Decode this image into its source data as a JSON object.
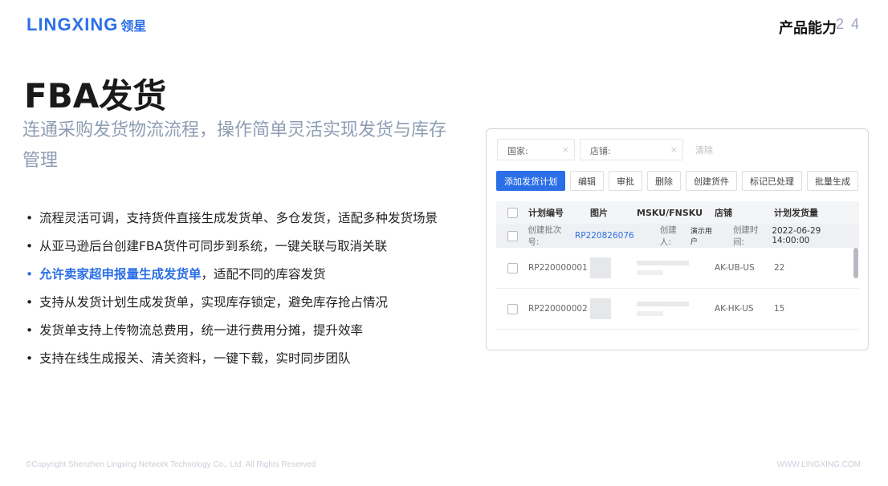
{
  "brand": {
    "name_en": "LINGXING",
    "name_cn": "领星"
  },
  "header": {
    "section": "产品能力",
    "page": "2 4"
  },
  "title": "FBA发货",
  "subtitle": "连通采购发货物流流程，操作简单灵活实现发货与库存管理",
  "bullets": [
    {
      "text": "流程灵活可调，支持货件直接生成发货单、多仓发货，适配多种发货场景"
    },
    {
      "text": "从亚马逊后台创建FBA货件可同步到系统，一键关联与取消关联"
    },
    {
      "strong": "允许卖家超申报量生成发货单",
      "text": "，适配不同的库容发货"
    },
    {
      "text": "支持从发货计划生成发货单，实现库存锁定，避免库存抢占情况"
    },
    {
      "text": "发货单支持上传物流总费用，统一进行费用分摊，提升效率"
    },
    {
      "text": "支持在线生成报关、清关资料，一键下载，实时同步团队"
    }
  ],
  "ui": {
    "filters": {
      "country": "国家:",
      "shop": "店铺:",
      "clear": "清除",
      "clear_icon": "×"
    },
    "toolbar": [
      "添加发货计划",
      "编辑",
      "审批",
      "删除",
      "创建货件",
      "标记已处理",
      "批量生成"
    ],
    "table": {
      "headers": {
        "plan_no": "计划编号",
        "image": "图片",
        "msku": "MSKU/FNSKU",
        "shop": "店铺",
        "qty": "计划发货量"
      },
      "batch": {
        "batch_label": "创建批次号:",
        "batch_no": "RP220826076",
        "creator_label": "创建人:",
        "creator": "演示用户",
        "time_label": "创建时间:",
        "time": "2022-06-29 14:00:00"
      },
      "rows": [
        {
          "plan_no": "RP220000001",
          "shop": "AK-UB-US",
          "qty": "22"
        },
        {
          "plan_no": "RP220000002",
          "shop": "AK-HK-US",
          "qty": "15"
        }
      ]
    }
  },
  "footer": {
    "copyright": "©Copyright Shenzhen Lingxing Network Technology Co., Ltd. All Rights Reserved",
    "website": "WWW.LINGXING.COM"
  },
  "colors": {
    "accent": "#2b6fe8",
    "subtitle": "#8e9db3"
  }
}
